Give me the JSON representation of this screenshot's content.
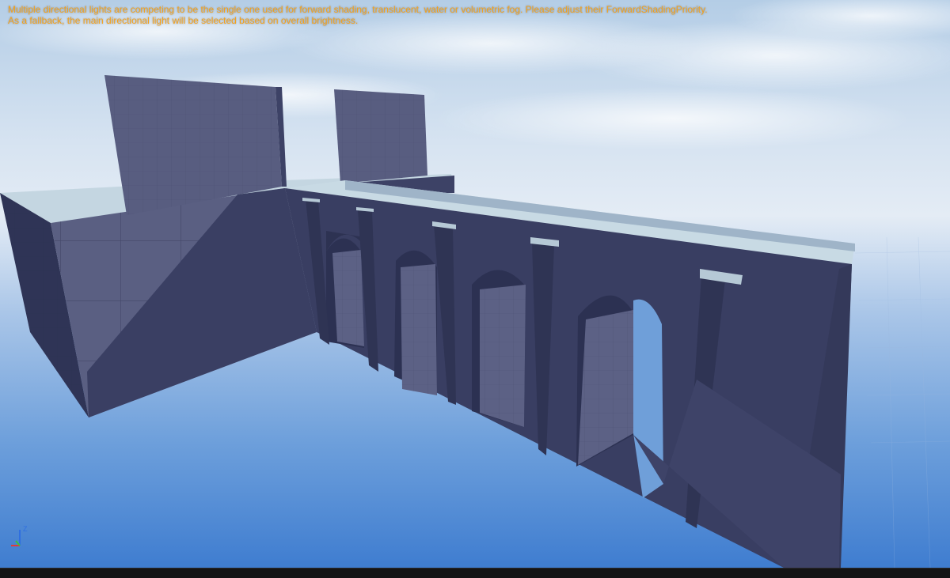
{
  "viewport": {
    "warning": {
      "line1": "Multiple directional lights are competing to be the single one used for forward shading, translucent, water or volumetric fog. Please adjust their ForwardShadingPriority.",
      "line2": "As a fallback, the main directional light will be selected based on overall brightness."
    },
    "axis_gizmo": {
      "z_label": "Z",
      "icon": "axis-gizmo-icon"
    },
    "colors": {
      "warning_text": "#f6a21a",
      "sky_top": "#bcd3e8",
      "sky_horizon": "#dfe8f3",
      "floor": "#4e86cc",
      "wall_dark": "#353a5c",
      "wall_lit": "#5a5f82",
      "wall_top": "#c6d8e2"
    }
  }
}
